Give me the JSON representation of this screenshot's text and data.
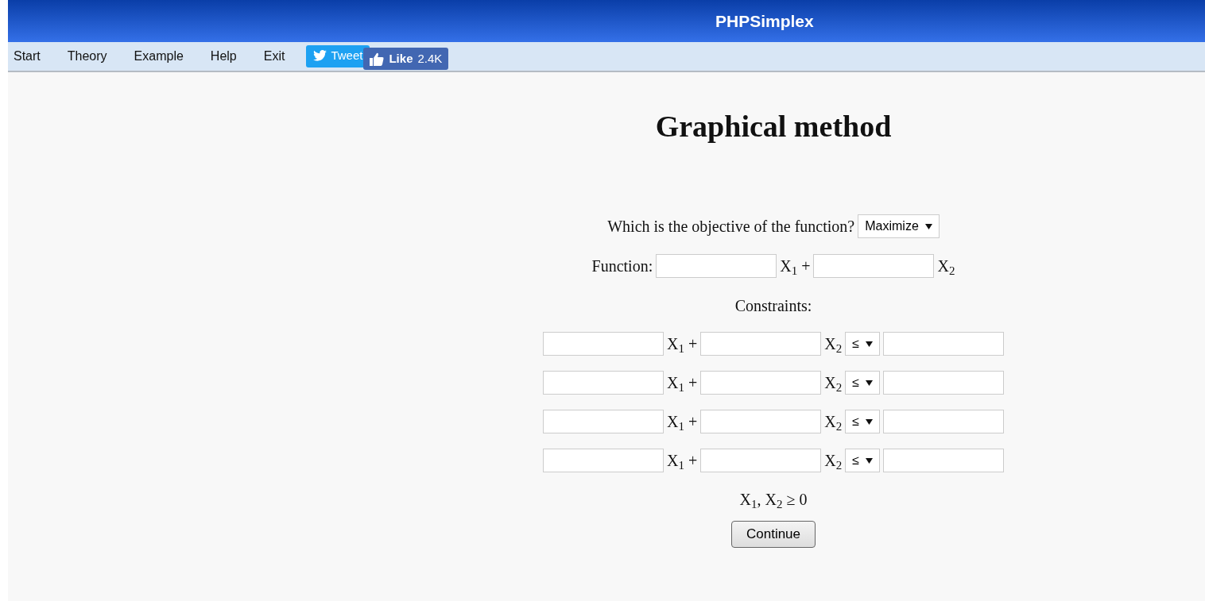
{
  "header": {
    "title": "PHPSimplex"
  },
  "nav": {
    "items": [
      "Start",
      "Theory",
      "Example",
      "Help",
      "Exit"
    ],
    "tweet": {
      "label": "Tweet"
    },
    "like": {
      "label": "Like",
      "count": "2.4K"
    }
  },
  "heading": "Graphical method",
  "objective": {
    "question": "Which is the objective of the function?",
    "value": "Maximize"
  },
  "function": {
    "label": "Function:",
    "terms": [
      "X$_{1}$ +",
      "X$_{2}$"
    ]
  },
  "constraints_label": "Constraints:",
  "constraints": [
    {
      "terms": [
        "X$_{1}$ +",
        "X$_{2}$"
      ],
      "operator": "≤"
    },
    {
      "terms": [
        "X$_{1}$ +",
        "X$_{2}$"
      ],
      "operator": "≤"
    },
    {
      "terms": [
        "X$_{1}$ +",
        "X$_{2}$"
      ],
      "operator": "≤"
    },
    {
      "terms": [
        "X$_{1}$ +",
        "X$_{2}$"
      ],
      "operator": "≤"
    }
  ],
  "nonnegativity": "X$_{1}$, X$_{2}$ ≥ 0",
  "submit": "Continue"
}
